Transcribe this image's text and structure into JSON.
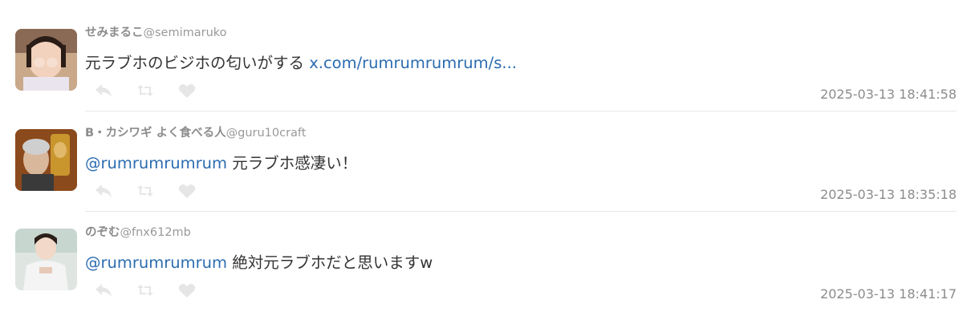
{
  "tweets": [
    {
      "display_name": "せみまるこ",
      "handle": "@semimaruko",
      "text": "元ラブホのビジホの匂いがする ",
      "link": "x.com/rumrumrumrum/s...",
      "timestamp": "2025-03-13 18:41:58",
      "avatar": "avatar-child-photo"
    },
    {
      "display_name": "B・カシワギ よく食べる人",
      "handle": "@guru10craft",
      "mention": "@rumrumrumrum",
      "text": " 元ラブホ感凄い！",
      "timestamp": "2025-03-13 18:35:18",
      "avatar": "avatar-elderly-photo"
    },
    {
      "display_name": "のぞむ",
      "handle": "@fnx612mb",
      "mention": "@rumrumrumrum",
      "text": " 絶対元ラブホだと思いますw",
      "timestamp": "2025-03-13 18:41:17",
      "avatar": "avatar-woman-photo"
    }
  ],
  "icons": {
    "reply": "reply-icon",
    "retweet": "retweet-icon",
    "like": "heart-icon"
  },
  "colors": {
    "link": "#2b6cb0",
    "meta": "#8c8c8c",
    "action_icon": "#e6e6e6",
    "divider": "#e8e8e8"
  }
}
